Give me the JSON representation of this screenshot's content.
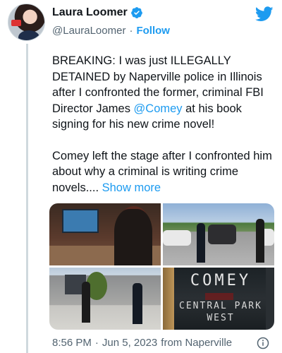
{
  "author": {
    "display_name": "Laura Loomer",
    "handle": "@LauraLoomer",
    "separator": "·",
    "follow_label": "Follow"
  },
  "tweet": {
    "paragraph1_a": "BREAKING: I was just ILLEGALLY DETAINED by Naperville police in Illinois after I confronted the former, criminal FBI Director James ",
    "mention": "@Comey",
    "paragraph1_b": " at his book signing for his new crime novel!",
    "paragraph2": "Comey left the stage after I confronted him about why a criminal is writing crime novels.... ",
    "show_more_label": "Show more"
  },
  "media": {
    "book_title": "COMEY",
    "book_subtitle": "CENTRAL PARK WEST"
  },
  "meta": {
    "time": "8:56 PM",
    "dot": "·",
    "date": "Jun 5, 2023",
    "source": "from Naperville"
  },
  "colors": {
    "accent": "#1d9bf0",
    "secondary_text": "#536471",
    "primary_text": "#0f1419"
  },
  "icons": {
    "verified": "verified-badge-icon",
    "brand": "twitter-bird-icon",
    "info": "info-icon"
  }
}
